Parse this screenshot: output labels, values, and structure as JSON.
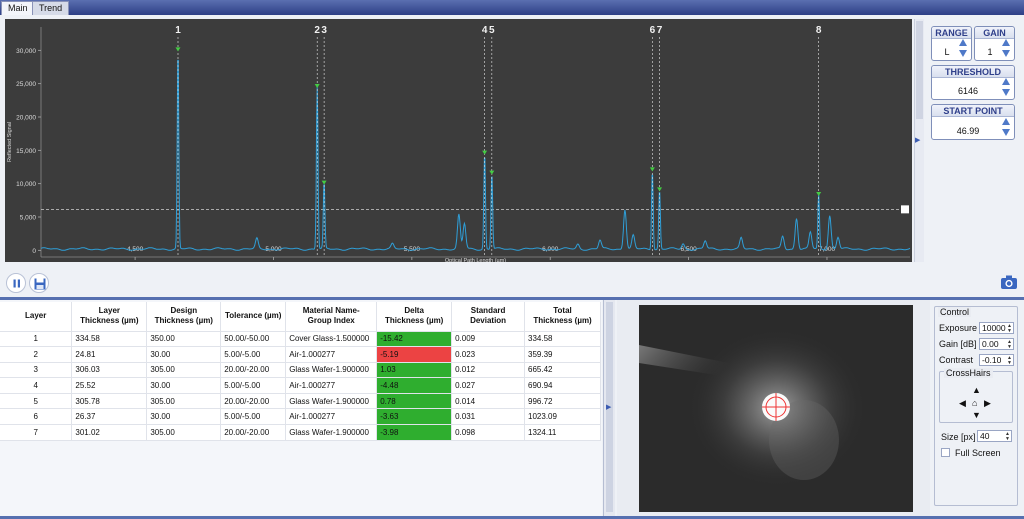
{
  "tabs": [
    {
      "label": "Main"
    },
    {
      "label": "Trend"
    }
  ],
  "controls": {
    "range": {
      "title": "RANGE",
      "value": "L"
    },
    "gain": {
      "title": "GAIN",
      "value": "1"
    },
    "threshold": {
      "title": "THRESHOLD",
      "value": "6146"
    },
    "start_point": {
      "title": "START POINT",
      "value": "46.99"
    }
  },
  "chart_data": {
    "type": "line",
    "xlabel": "Optical Path Length (µm)",
    "ylabel": "Reflected Signal",
    "xlim": [
      4160,
      7300
    ],
    "ylim": [
      -1000,
      33500
    ],
    "x_ticks": [
      4500,
      5000,
      5500,
      6000,
      6500,
      7000
    ],
    "x_tick_labels": [
      "4,500",
      "5,000",
      "5,500",
      "6,000",
      "6,500",
      "7,000"
    ],
    "y_ticks": [
      0,
      5000,
      10000,
      15000,
      20000,
      25000,
      30000
    ],
    "y_tick_labels": [
      "0",
      "5,000",
      "10,000",
      "15,000",
      "20,000",
      "25,000",
      "30,000"
    ],
    "threshold": 6146,
    "line_color": "#2f9fd8",
    "marker_color": "#44cc44",
    "peaks": [
      {
        "label": "1",
        "x": 4655,
        "y": 30000
      },
      {
        "label": "2",
        "x": 5158,
        "y": 24500
      },
      {
        "label": "3",
        "x": 5183,
        "y": 10000
      },
      {
        "label": "4",
        "x": 5763,
        "y": 14500
      },
      {
        "label": "5",
        "x": 5789,
        "y": 11500
      },
      {
        "label": "6",
        "x": 6369,
        "y": 12000
      },
      {
        "label": "7",
        "x": 6395,
        "y": 9000
      },
      {
        "label": "8",
        "x": 6970,
        "y": 8300
      }
    ],
    "minor_peaks": [
      {
        "x": 4940,
        "y": 1500
      },
      {
        "x": 5430,
        "y": 700
      },
      {
        "x": 5670,
        "y": 5100
      },
      {
        "x": 5690,
        "y": 3800
      },
      {
        "x": 6100,
        "y": 700
      },
      {
        "x": 6180,
        "y": 1300
      },
      {
        "x": 6270,
        "y": 6000
      },
      {
        "x": 6300,
        "y": 2000
      },
      {
        "x": 6480,
        "y": 800
      },
      {
        "x": 6560,
        "y": 1200
      },
      {
        "x": 6690,
        "y": 1600
      },
      {
        "x": 6840,
        "y": 1900
      },
      {
        "x": 6890,
        "y": 4700
      },
      {
        "x": 6940,
        "y": 2500
      },
      {
        "x": 7010,
        "y": 5100
      },
      {
        "x": 7040,
        "y": 1800
      }
    ]
  },
  "table": {
    "headers": [
      {
        "l1": "Layer",
        "l2": ""
      },
      {
        "l1": "Layer",
        "l2": "Thickness (µm)"
      },
      {
        "l1": "Design",
        "l2": "Thickness (µm)"
      },
      {
        "l1": "Tolerance (µm)",
        "l2": ""
      },
      {
        "l1": "Material Name-",
        "l2": "Group Index"
      },
      {
        "l1": "Delta",
        "l2": "Thickness (µm)"
      },
      {
        "l1": "Standard",
        "l2": "Deviation"
      },
      {
        "l1": "Total",
        "l2": "Thickness (µm)"
      }
    ],
    "rows": [
      {
        "layer": "1",
        "thickness": "334.58",
        "design": "350.00",
        "tolerance": "50.00/-50.00",
        "material": "Cover Glass-1.500000",
        "delta": "-15.42",
        "status": "green",
        "std": "0.009",
        "total": "334.58"
      },
      {
        "layer": "2",
        "thickness": "24.81",
        "design": "30.00",
        "tolerance": "5.00/-5.00",
        "material": "Air-1.000277",
        "delta": "-5.19",
        "status": "red",
        "std": "0.023",
        "total": "359.39"
      },
      {
        "layer": "3",
        "thickness": "306.03",
        "design": "305.00",
        "tolerance": "20.00/-20.00",
        "material": "Glass Wafer-1.900000",
        "delta": "1.03",
        "status": "green",
        "std": "0.012",
        "total": "665.42"
      },
      {
        "layer": "4",
        "thickness": "25.52",
        "design": "30.00",
        "tolerance": "5.00/-5.00",
        "material": "Air-1.000277",
        "delta": "-4.48",
        "status": "green",
        "std": "0.027",
        "total": "690.94"
      },
      {
        "layer": "5",
        "thickness": "305.78",
        "design": "305.00",
        "tolerance": "20.00/-20.00",
        "material": "Glass Wafer-1.900000",
        "delta": "0.78",
        "status": "green",
        "std": "0.014",
        "total": "996.72"
      },
      {
        "layer": "6",
        "thickness": "26.37",
        "design": "30.00",
        "tolerance": "5.00/-5.00",
        "material": "Air-1.000277",
        "delta": "-3.63",
        "status": "green",
        "std": "0.031",
        "total": "1023.09"
      },
      {
        "layer": "7",
        "thickness": "301.02",
        "design": "305.00",
        "tolerance": "20.00/-20.00",
        "material": "Glass Wafer-1.900000",
        "delta": "-3.98",
        "status": "green",
        "std": "0.098",
        "total": "1324.11"
      }
    ]
  },
  "camera_control": {
    "group_title": "Control",
    "exposure_label": "Exposure",
    "exposure_value": "10000",
    "gain_label": "Gain [dB]",
    "gain_value": "0.00",
    "contrast_label": "Contrast",
    "contrast_value": "-0.10",
    "crosshairs_label": "CrossHairs",
    "size_label": "Size [px]",
    "size_value": "40",
    "fullscreen_label": "Full Screen"
  }
}
